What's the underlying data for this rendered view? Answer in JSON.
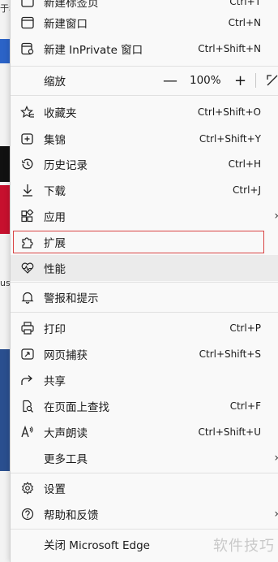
{
  "menu": {
    "top_partial": {
      "label": "新建标签页",
      "shortcut": "Ctrl+T"
    },
    "new_window": {
      "label": "新建窗口",
      "shortcut": "Ctrl+N"
    },
    "new_inprivate": {
      "label": "新建 InPrivate 窗口",
      "shortcut": "Ctrl+Shift+N"
    },
    "zoom": {
      "label": "缩放",
      "minus": "—",
      "value": "100%",
      "plus": "+"
    },
    "favorites": {
      "label": "收藏夹",
      "shortcut": "Ctrl+Shift+O"
    },
    "collections": {
      "label": "集锦",
      "shortcut": "Ctrl+Shift+Y"
    },
    "history": {
      "label": "历史记录",
      "shortcut": "Ctrl+H"
    },
    "downloads": {
      "label": "下载",
      "shortcut": "Ctrl+J"
    },
    "apps": {
      "label": "应用",
      "chevron": "›"
    },
    "extensions": {
      "label": "扩展"
    },
    "performance": {
      "label": "性能"
    },
    "alerts": {
      "label": "警报和提示"
    },
    "print": {
      "label": "打印",
      "shortcut": "Ctrl+P"
    },
    "web_capture": {
      "label": "网页捕获",
      "shortcut": "Ctrl+Shift+S"
    },
    "share": {
      "label": "共享"
    },
    "find": {
      "label": "在页面上查找",
      "shortcut": "Ctrl+F"
    },
    "read_aloud": {
      "label": "大声朗读",
      "shortcut": "Ctrl+Shift+U"
    },
    "more_tools": {
      "label": "更多工具",
      "chevron": "›"
    },
    "settings": {
      "label": "设置"
    },
    "help": {
      "label": "帮助和反馈",
      "chevron": "›"
    },
    "close": {
      "label": "关闭 Microsoft Edge"
    }
  },
  "background": {
    "fragment_1": "于看",
    "fragment_2": "us"
  },
  "watermark": "软件技巧",
  "colors": {
    "highlight_border": "#d94343",
    "hover_bg": "#ebebeb",
    "menu_bg": "#f9f9f9"
  }
}
